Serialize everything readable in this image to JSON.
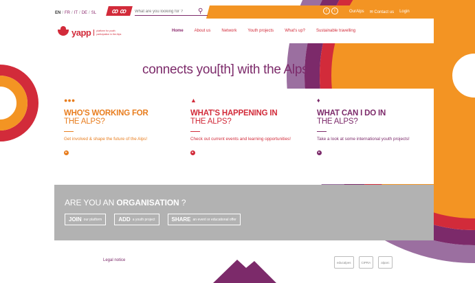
{
  "topbar": {
    "languages": [
      "EN",
      "FR",
      "IT",
      "DE",
      "SL"
    ],
    "accessibility_label": "ꝏ ꝏ",
    "search_placeholder": "What are you looking for ?",
    "social": [
      "f",
      "t"
    ],
    "links": [
      "OurAlps",
      "✉ Contact us",
      "Login"
    ]
  },
  "logo": {
    "word": "yapp",
    "tagline": "platform for youth participation in the Alps"
  },
  "nav": [
    "Home",
    "About us",
    "Network",
    "Youth projects",
    "What's up?",
    "Sustainable travelling"
  ],
  "headline": "connects you[th] with the Alps",
  "cards": [
    {
      "title1": "WHO'S WORKING FOR",
      "title2": "THE ALPS?",
      "desc": "Get involved & shape the future of the Alps!",
      "icon": "people-icon"
    },
    {
      "title1": "WHAT'S HAPPENING IN",
      "title2": "THE ALPS?",
      "desc": "Check out current events and learning opportunities!",
      "icon": "hat-icon"
    },
    {
      "title1": "WHAT CAN I DO IN",
      "title2": "THE ALPS?",
      "desc": "Take a look at some international youth projects!",
      "icon": "leaf-icon"
    }
  ],
  "organisation": {
    "q_prefix": "ARE YOU AN ",
    "q_bold": "ORGANISATION",
    "q_suffix": " ?",
    "buttons": [
      {
        "bold": "JOIN",
        "small": "our platform"
      },
      {
        "bold": "ADD",
        "small": "a youth project"
      },
      {
        "bold": "SHARE",
        "small": "an event or educational offer"
      }
    ]
  },
  "footer": {
    "legal": "Legal notice",
    "partners": [
      "educalpes",
      "CIPRA",
      "alparc"
    ]
  },
  "colors": {
    "orange": "#f39423",
    "red": "#d22b3a",
    "purple": "#7c2a6a",
    "lilac": "#9b6fa0",
    "grey": "#b2b2b2"
  }
}
